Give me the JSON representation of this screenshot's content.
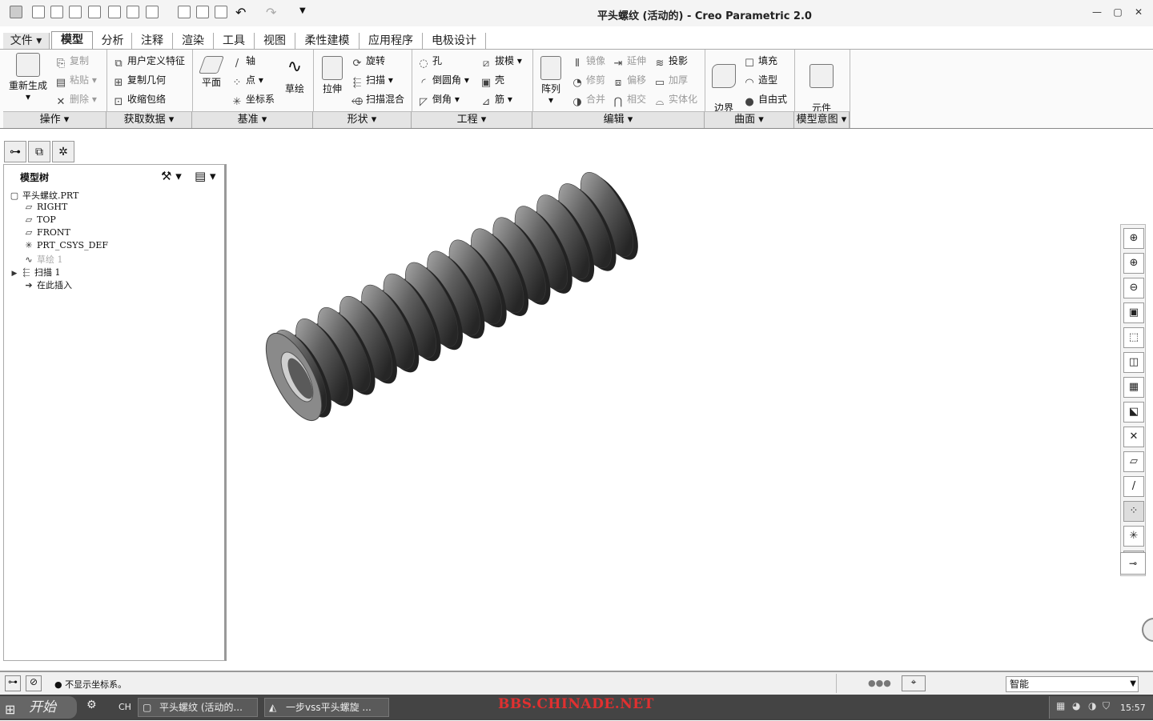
{
  "window": {
    "title": "平头螺纹 (活动的) - Creo Parametric 2.0",
    "minimize": "—",
    "restore": "▢",
    "close": "✕"
  },
  "tabs": [
    "文件",
    "模型",
    "分析",
    "注释",
    "渲染",
    "工具",
    "视图",
    "柔性建模",
    "应用程序",
    "电极设计"
  ],
  "active_tab": "模型",
  "ribbon": {
    "regenerate": "重新生成",
    "copy": "复制",
    "paste": "粘贴",
    "delete": "删除",
    "udf": "用户定义特征",
    "copy_geom": "复制几何",
    "shrinkwrap": "收缩包络",
    "plane": "平面",
    "axis": "轴",
    "point": "点",
    "csys": "坐标系",
    "sketch": "草绘",
    "extrude": "拉伸",
    "revolve": "旋转",
    "sweep": "扫描",
    "swept_blend": "扫描混合",
    "hole": "孔",
    "round": "倒圆角",
    "chamfer": "倒角",
    "draft": "拔模",
    "shell": "壳",
    "rib": "筋",
    "pattern": "阵列",
    "mirror": "镜像",
    "trim": "修剪",
    "merge": "合并",
    "extend": "延伸",
    "offset": "偏移",
    "intersect": "相交",
    "project": "投影",
    "thicken": "加厚",
    "solidify": "实体化",
    "boundary_blend": "边界\n混合",
    "fill": "填充",
    "style": "造型",
    "freestyle": "自由式",
    "component_interface": "元件\n界面"
  },
  "groups": [
    "操作 ▾",
    "获取数据 ▾",
    "基准 ▾",
    "形状 ▾",
    "工程 ▾",
    "编辑 ▾",
    "曲面 ▾",
    "模型意图 ▾"
  ],
  "tree": {
    "header": "模型树",
    "root": "平头螺纹.PRT",
    "items": [
      "RIGHT",
      "TOP",
      "FRONT",
      "PRT_CSYS_DEF",
      "草绘 1",
      "扫描 1",
      "在此插入"
    ]
  },
  "status": {
    "message": "● 不显示坐标系。",
    "filter": "智能"
  },
  "taskbar": {
    "start": "开始",
    "lang": "CH",
    "task1": "平头螺纹 (活动的...",
    "task2": "一步vss平头螺旋 ...",
    "watermark": "BBS.CHINADE.NET",
    "clock": "15:57"
  }
}
